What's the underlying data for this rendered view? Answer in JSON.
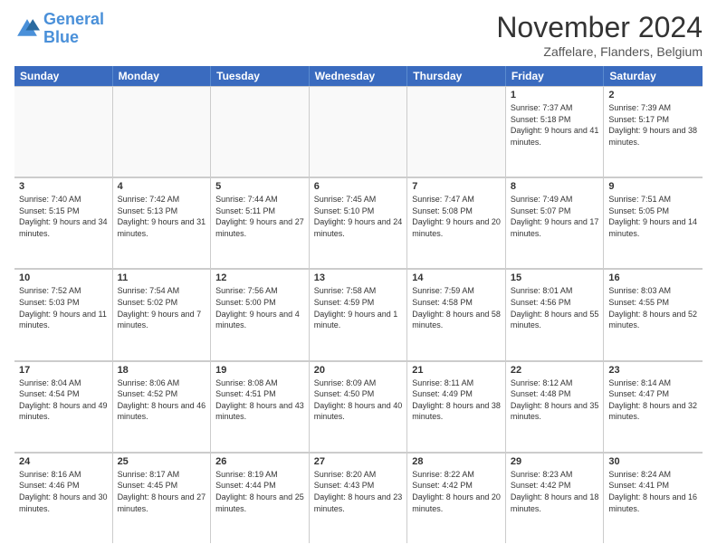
{
  "header": {
    "logo_line1": "General",
    "logo_line2": "Blue",
    "month": "November 2024",
    "location": "Zaffelare, Flanders, Belgium"
  },
  "weekdays": [
    "Sunday",
    "Monday",
    "Tuesday",
    "Wednesday",
    "Thursday",
    "Friday",
    "Saturday"
  ],
  "weeks": [
    [
      {
        "day": "",
        "info": ""
      },
      {
        "day": "",
        "info": ""
      },
      {
        "day": "",
        "info": ""
      },
      {
        "day": "",
        "info": ""
      },
      {
        "day": "",
        "info": ""
      },
      {
        "day": "1",
        "info": "Sunrise: 7:37 AM\nSunset: 5:18 PM\nDaylight: 9 hours and 41 minutes."
      },
      {
        "day": "2",
        "info": "Sunrise: 7:39 AM\nSunset: 5:17 PM\nDaylight: 9 hours and 38 minutes."
      }
    ],
    [
      {
        "day": "3",
        "info": "Sunrise: 7:40 AM\nSunset: 5:15 PM\nDaylight: 9 hours and 34 minutes."
      },
      {
        "day": "4",
        "info": "Sunrise: 7:42 AM\nSunset: 5:13 PM\nDaylight: 9 hours and 31 minutes."
      },
      {
        "day": "5",
        "info": "Sunrise: 7:44 AM\nSunset: 5:11 PM\nDaylight: 9 hours and 27 minutes."
      },
      {
        "day": "6",
        "info": "Sunrise: 7:45 AM\nSunset: 5:10 PM\nDaylight: 9 hours and 24 minutes."
      },
      {
        "day": "7",
        "info": "Sunrise: 7:47 AM\nSunset: 5:08 PM\nDaylight: 9 hours and 20 minutes."
      },
      {
        "day": "8",
        "info": "Sunrise: 7:49 AM\nSunset: 5:07 PM\nDaylight: 9 hours and 17 minutes."
      },
      {
        "day": "9",
        "info": "Sunrise: 7:51 AM\nSunset: 5:05 PM\nDaylight: 9 hours and 14 minutes."
      }
    ],
    [
      {
        "day": "10",
        "info": "Sunrise: 7:52 AM\nSunset: 5:03 PM\nDaylight: 9 hours and 11 minutes."
      },
      {
        "day": "11",
        "info": "Sunrise: 7:54 AM\nSunset: 5:02 PM\nDaylight: 9 hours and 7 minutes."
      },
      {
        "day": "12",
        "info": "Sunrise: 7:56 AM\nSunset: 5:00 PM\nDaylight: 9 hours and 4 minutes."
      },
      {
        "day": "13",
        "info": "Sunrise: 7:58 AM\nSunset: 4:59 PM\nDaylight: 9 hours and 1 minute."
      },
      {
        "day": "14",
        "info": "Sunrise: 7:59 AM\nSunset: 4:58 PM\nDaylight: 8 hours and 58 minutes."
      },
      {
        "day": "15",
        "info": "Sunrise: 8:01 AM\nSunset: 4:56 PM\nDaylight: 8 hours and 55 minutes."
      },
      {
        "day": "16",
        "info": "Sunrise: 8:03 AM\nSunset: 4:55 PM\nDaylight: 8 hours and 52 minutes."
      }
    ],
    [
      {
        "day": "17",
        "info": "Sunrise: 8:04 AM\nSunset: 4:54 PM\nDaylight: 8 hours and 49 minutes."
      },
      {
        "day": "18",
        "info": "Sunrise: 8:06 AM\nSunset: 4:52 PM\nDaylight: 8 hours and 46 minutes."
      },
      {
        "day": "19",
        "info": "Sunrise: 8:08 AM\nSunset: 4:51 PM\nDaylight: 8 hours and 43 minutes."
      },
      {
        "day": "20",
        "info": "Sunrise: 8:09 AM\nSunset: 4:50 PM\nDaylight: 8 hours and 40 minutes."
      },
      {
        "day": "21",
        "info": "Sunrise: 8:11 AM\nSunset: 4:49 PM\nDaylight: 8 hours and 38 minutes."
      },
      {
        "day": "22",
        "info": "Sunrise: 8:12 AM\nSunset: 4:48 PM\nDaylight: 8 hours and 35 minutes."
      },
      {
        "day": "23",
        "info": "Sunrise: 8:14 AM\nSunset: 4:47 PM\nDaylight: 8 hours and 32 minutes."
      }
    ],
    [
      {
        "day": "24",
        "info": "Sunrise: 8:16 AM\nSunset: 4:46 PM\nDaylight: 8 hours and 30 minutes."
      },
      {
        "day": "25",
        "info": "Sunrise: 8:17 AM\nSunset: 4:45 PM\nDaylight: 8 hours and 27 minutes."
      },
      {
        "day": "26",
        "info": "Sunrise: 8:19 AM\nSunset: 4:44 PM\nDaylight: 8 hours and 25 minutes."
      },
      {
        "day": "27",
        "info": "Sunrise: 8:20 AM\nSunset: 4:43 PM\nDaylight: 8 hours and 23 minutes."
      },
      {
        "day": "28",
        "info": "Sunrise: 8:22 AM\nSunset: 4:42 PM\nDaylight: 8 hours and 20 minutes."
      },
      {
        "day": "29",
        "info": "Sunrise: 8:23 AM\nSunset: 4:42 PM\nDaylight: 8 hours and 18 minutes."
      },
      {
        "day": "30",
        "info": "Sunrise: 8:24 AM\nSunset: 4:41 PM\nDaylight: 8 hours and 16 minutes."
      }
    ]
  ]
}
